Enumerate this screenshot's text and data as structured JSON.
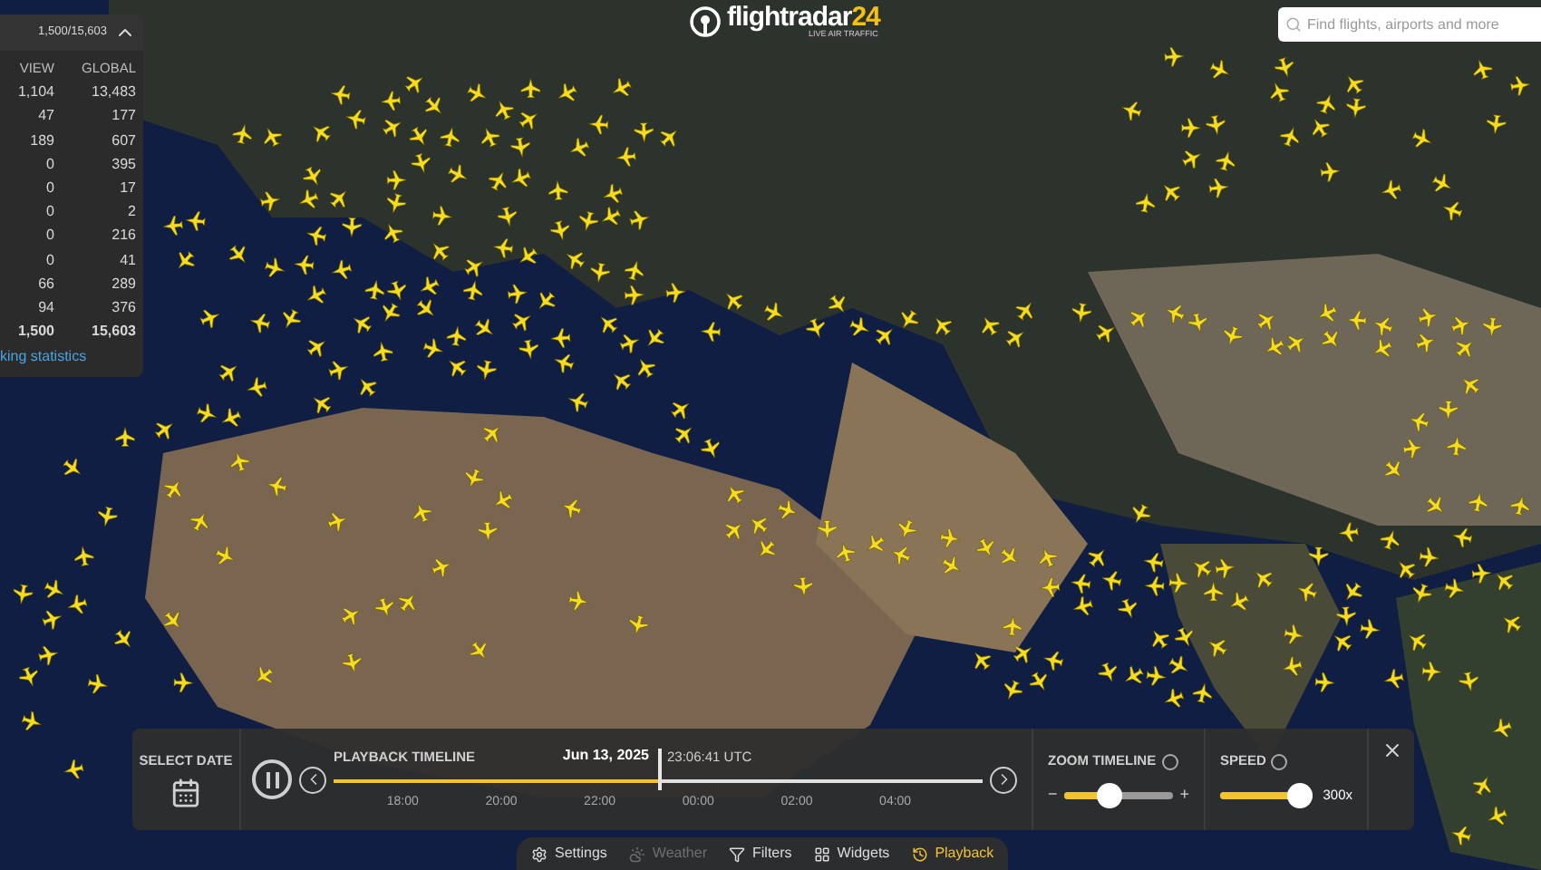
{
  "stats_panel": {
    "summary": "1,500/15,603",
    "expanded": true,
    "columns": [
      "VIEW",
      "GLOBAL"
    ],
    "rows": [
      [
        "1,104",
        "13,483"
      ],
      [
        "47",
        "177"
      ],
      [
        "189",
        "607"
      ],
      [
        "0",
        "395"
      ],
      [
        "0",
        "17"
      ],
      [
        "0",
        "2"
      ],
      [
        "0",
        "216"
      ],
      [
        "0",
        "41"
      ],
      [
        "66",
        "289"
      ],
      [
        "94",
        "376"
      ]
    ],
    "total": [
      "1,500",
      "15,603"
    ],
    "link": "king statistics"
  },
  "logo": {
    "name": "flightradar",
    "suffix": "24",
    "tagline": "LIVE AIR TRAFFIC"
  },
  "search": {
    "placeholder": "Find flights, airports and more"
  },
  "playback": {
    "select_date": "SELECT DATE",
    "playing": true,
    "timeline_title": "PLAYBACK TIMELINE",
    "date": "Jun 13, 2025",
    "time": "23:06:41 UTC",
    "level": 0.5,
    "ticks": [
      "18:00",
      "20:00",
      "22:00",
      "00:00",
      "02:00",
      "04:00"
    ],
    "zoom": {
      "label": "ZOOM TIMELINE",
      "minus": "−",
      "plus": "+",
      "level": 0.38
    },
    "speed": {
      "label": "SPEED",
      "level": 1,
      "value": "300x"
    }
  },
  "bottom_menu": [
    {
      "kind": "settings",
      "label": "Settings",
      "selected": false,
      "disabled": false
    },
    {
      "kind": "weather",
      "label": "Weather",
      "selected": false,
      "disabled": true
    },
    {
      "kind": "filters",
      "label": "Filters",
      "selected": false,
      "disabled": false
    },
    {
      "kind": "widgets",
      "label": "Widgets",
      "selected": false,
      "disabled": false
    },
    {
      "kind": "playback",
      "label": "Playback",
      "selected": true,
      "disabled": false
    }
  ]
}
